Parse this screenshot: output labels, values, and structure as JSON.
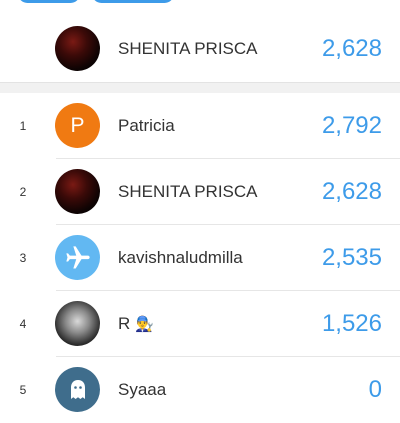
{
  "colors": {
    "accent": "#3d9be9",
    "letter_avatar": "#f07a12",
    "plane_avatar": "#62b8f2",
    "ghost_avatar": "#3f6d8c"
  },
  "current_user": {
    "name": "SHENITA PRISCA",
    "score": "2,628",
    "avatar": "photo-avatar"
  },
  "leaderboard": [
    {
      "rank": "1",
      "name": "Patricia",
      "score": "2,792",
      "avatar_letter": "P"
    },
    {
      "rank": "2",
      "name": "SHENITA PRISCA",
      "score": "2,628",
      "avatar": "photo-avatar"
    },
    {
      "rank": "3",
      "name": "kavishnaludmilla",
      "score": "2,535",
      "avatar": "airplane-icon"
    },
    {
      "rank": "4",
      "name": "R",
      "name_emoji": "👨‍🔧",
      "score": "1,526",
      "avatar": "photo-avatar"
    },
    {
      "rank": "5",
      "name": "Syaaa",
      "score": "0",
      "avatar": "ghost-icon"
    }
  ]
}
